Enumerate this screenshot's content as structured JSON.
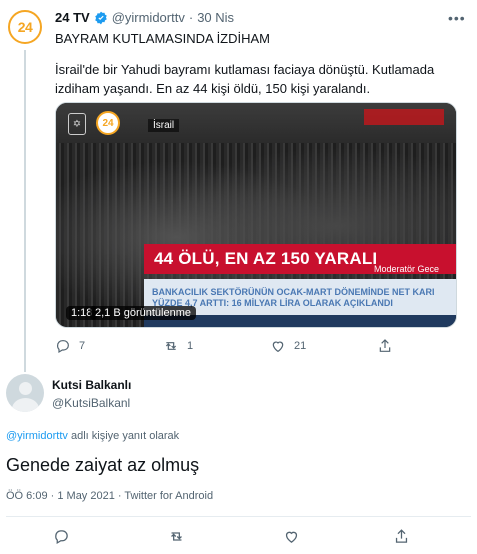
{
  "parent_tweet": {
    "logo_text": "24",
    "name": "24 TV",
    "handle": "@yirmidorttv",
    "separator": "·",
    "date": "30 Nis",
    "title": "BAYRAM KUTLAMASINDA İZDİHAM",
    "body": "İsrail'de bir Yahudi bayramı kutlaması faciaya dönüştü. Kutlamada izdiham yaşandı. En az 44 kişi öldü, 150 kişi yaralandı.",
    "video": {
      "channel_logo": "24",
      "location": "İsrail",
      "headline": "44 ÖLÜ, EN AZ 150 YARALI",
      "moderator": "Moderatör Gece",
      "ticker": "BANKACILIK SEKTÖRÜNÜN OCAK-MART DÖNEMİNDE NET KARI YÜZDE 4,7 ARTTI: 16 MİLYAR LİRA OLARAK AÇIKLANDI",
      "duration": "1:18",
      "views": "2,1 B görüntülenme"
    },
    "actions": {
      "replies": "7",
      "retweets": "1",
      "likes": "21"
    }
  },
  "main_tweet": {
    "name": "Kutsi Balkanlı",
    "handle": "@KutsiBalkanl",
    "reply_mention": "@yirmidorttv",
    "reply_suffix": " adlı kişiye yanıt olarak",
    "text": "Genede zaiyat az olmuş",
    "meta": "ÖÖ 6:09 · 1 May 2021 · Twitter for Android"
  },
  "colors": {
    "accent": "#1d9bf0",
    "brand_orange": "#f5a623",
    "headline_red": "#c8102e"
  },
  "icons": [
    "verified-icon",
    "more-icon",
    "reply-icon",
    "retweet-icon",
    "like-icon",
    "share-icon"
  ]
}
